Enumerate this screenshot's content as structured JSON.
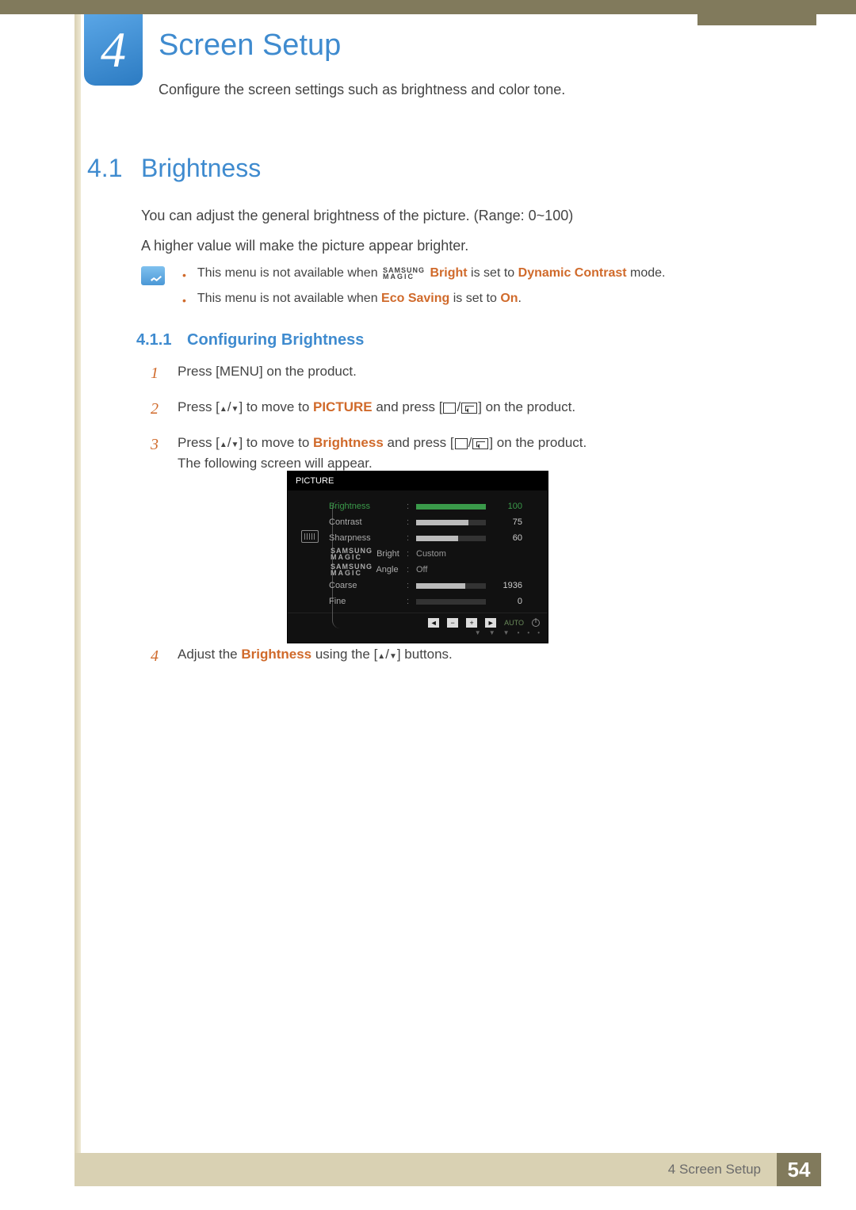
{
  "chapter": {
    "number": "4",
    "title": "Screen Setup",
    "description": "Configure the screen settings such as brightness and color tone."
  },
  "section": {
    "number": "4.1",
    "title": "Brightness",
    "para1": "You can adjust the general brightness of the picture. (Range: 0~100)",
    "para2": "A higher value will make the picture appear brighter."
  },
  "notes": {
    "item1_prefix": "This menu is not available when ",
    "item1_magic": "SAMSUNG MAGIC",
    "item1_bright": "Bright",
    "item1_mid": " is set to ",
    "item1_hl": "Dynamic Contrast",
    "item1_suffix": " mode.",
    "item2_prefix": "This menu is not available when ",
    "item2_hl1": "Eco Saving",
    "item2_mid": " is set to ",
    "item2_hl2": "On",
    "item2_suffix": "."
  },
  "subsection": {
    "number": "4.1.1",
    "title": "Configuring Brightness"
  },
  "steps": {
    "s1_num": "1",
    "s1_a": "Press [",
    "s1_menu": "MENU",
    "s1_b": "] on the product.",
    "s2_num": "2",
    "s2_a": "Press [",
    "s2_b": "] to move to ",
    "s2_hl": "PICTURE",
    "s2_c": " and press [",
    "s2_d": "] on the product.",
    "s3_num": "3",
    "s3_a": "Press [",
    "s3_b": "] to move to ",
    "s3_hl": "Brightness",
    "s3_c": " and press [",
    "s3_d": "] on the product.",
    "s3_line2": "The following screen will appear.",
    "s4_num": "4",
    "s4_a": "Adjust the ",
    "s4_hl": "Brightness",
    "s4_b": " using the [",
    "s4_c": "] buttons."
  },
  "osd": {
    "title": "PICTURE",
    "rows": [
      {
        "label": "Brightness",
        "value": "100",
        "bar_pct": 100,
        "type": "bar",
        "active": true
      },
      {
        "label": "Contrast",
        "value": "75",
        "bar_pct": 75,
        "type": "bar",
        "active": false
      },
      {
        "label": "Sharpness",
        "value": "60",
        "bar_pct": 60,
        "type": "bar",
        "active": false
      },
      {
        "label": "SAMSUNG MAGIC Bright",
        "value": "Custom",
        "type": "text",
        "active": false
      },
      {
        "label": "SAMSUNG MAGIC Angle",
        "value": "Off",
        "type": "text",
        "active": false
      },
      {
        "label": "Coarse",
        "value": "1936",
        "bar_pct": 70,
        "type": "bar",
        "active": false
      },
      {
        "label": "Fine",
        "value": "0",
        "bar_pct": 0,
        "type": "bar",
        "active": false
      }
    ],
    "nav_auto": "AUTO"
  },
  "footer": {
    "chapter_label": "4 Screen Setup",
    "page_number": "54"
  }
}
